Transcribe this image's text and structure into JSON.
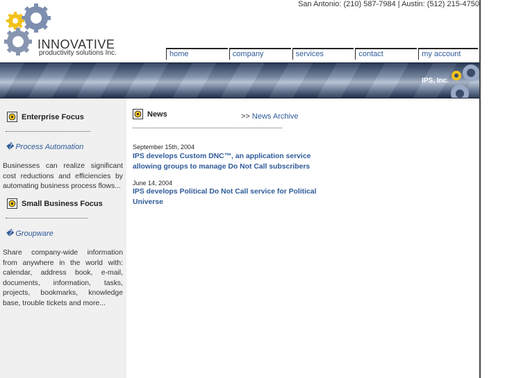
{
  "header": {
    "logo_word": "INNOVATIVE",
    "logo_sub": "productivity solutions Inc.",
    "phone": "San Antonio: (210) 587-7984  |  Austin: (512) 215-4750"
  },
  "nav": {
    "items": [
      {
        "label": "home"
      },
      {
        "label": "company"
      },
      {
        "label": "services"
      },
      {
        "label": "contact"
      },
      {
        "label": "my account"
      }
    ]
  },
  "banner": {
    "text": "IPS, Inc."
  },
  "sidebar": {
    "section1": {
      "title": "Enterprise Focus",
      "link": "� Process Automation",
      "text": "Businesses can realize significant cost reductions and efficiencies by automating business process flows..."
    },
    "section2": {
      "title": "Small Business Focus",
      "link": "� Groupware",
      "text": "Share company-wide information from anywhere in the world with: calendar, address book, e-mail, documents, information, tasks, projects, bookmarks, knowledge base, trouble tickets and more..."
    }
  },
  "news": {
    "title": "News",
    "archive_prefix": ">> ",
    "archive_link": "News Archive",
    "items": [
      {
        "date": "September 15th, 2004",
        "title": "IPS develops Custom DNC™, an application service allowing groups to manage Do Not Call subscribers"
      },
      {
        "date": "June 14, 2004",
        "title": "IPS develops Political Do Not Call service for Political Universe"
      }
    ]
  },
  "colors": {
    "link": "#2e5a99",
    "sidebar_bg": "#f0f0f0",
    "gear_blue": "#7d8fb0",
    "gear_yellow": "#f2c21a"
  },
  "icons": {
    "section": "sun-gear-icon",
    "logo": "gears-logo-icon"
  }
}
